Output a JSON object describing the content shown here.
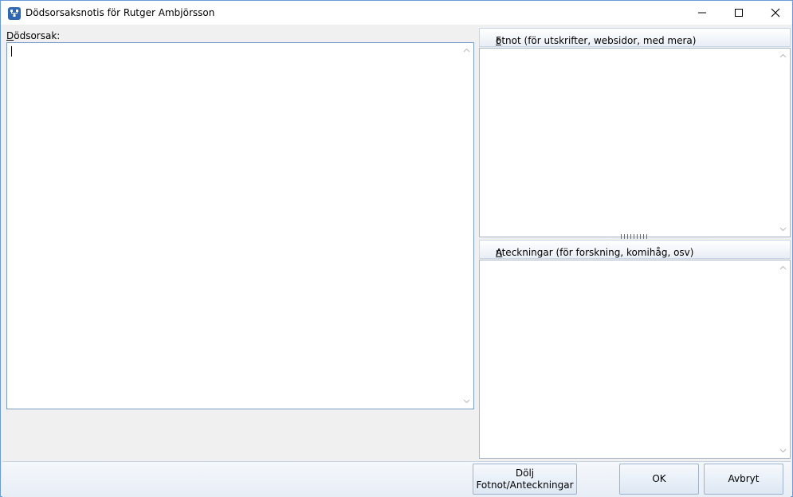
{
  "window": {
    "title": "Dödsorsaksnotis för Rutger Ambjörsson",
    "app_icon": "family-tree-app-icon",
    "controls": {
      "minimize": "minimize-icon",
      "maximize": "maximize-icon",
      "close": "close-icon"
    }
  },
  "main": {
    "label_access_key": "D",
    "label_rest": "ödsorsak:",
    "value": ""
  },
  "fotnot": {
    "header_access_key": "F",
    "header_rest": "otnot (för utskrifter, websidor, med mera)",
    "value": ""
  },
  "anteckningar": {
    "header_access_key": "A",
    "header_rest": "nteckningar (för forskning, komihåg, osv)",
    "value": ""
  },
  "buttons": {
    "dolj_line1": "Dölj",
    "dolj_line2": "Fotnot/Anteckningar",
    "ok": "OK",
    "avbryt": "Avbryt"
  }
}
